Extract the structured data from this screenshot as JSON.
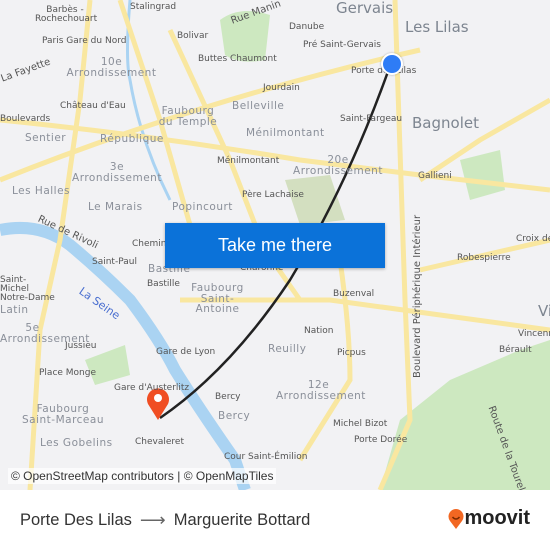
{
  "map": {
    "labels": [
      "Barbès - Rochechouart",
      "Stalingrad",
      "Rue Manin",
      "Gervais",
      "Les Lilas",
      "Bolivar",
      "Danube",
      "Paris Gare du Nord",
      "Pré Saint-Gervais",
      "La Fayette",
      "Buttes Chaumont",
      "Porte des Lilas",
      "10e Arrondissement",
      "Jourdain",
      "Château d'Eau",
      "Belleville",
      "Faubourg du Temple",
      "Bagnolet",
      "Saint-Fargeau",
      "Boulevards",
      "Sentier",
      "République",
      "Ménilmontant",
      "Ménilmontant",
      "20e Arrondissement",
      "Gallieni",
      "3e Arrondissement",
      "Les Halles",
      "Père Lachaise",
      "Le Marais",
      "Popincourt",
      "Rue de Rivoli",
      "Chemin",
      "Croix de",
      "Saint-Paul",
      "Bastille",
      "Charonne",
      "Robespierre",
      "Saint-Michel Notre-Dame",
      "Bastille",
      "Faubourg Saint-Antoine",
      "La Seine",
      "Buzenval",
      "Vi",
      "Latin",
      "5e Arrondissement",
      "Jussieu",
      "Nation",
      "Vincennes",
      "Reuilly",
      "Picpus",
      "Bérault",
      "Place Monge",
      "Gare de Lyon",
      "Boulevard Périphérique Intérieur",
      "Gare d'Austerlitz",
      "12e Arrondissement",
      "Route de la Tourelle",
      "Faubourg Saint-Marceau",
      "Bercy",
      "Bercy",
      "Michel Bizot",
      "Les Gobelins",
      "Chevaleret",
      "Porte Dorée",
      "Cour Saint-Émilion"
    ],
    "cta_label": "Take me there",
    "attribution": "© OpenStreetMap contributors | © OpenMapTiles",
    "origin_marker_color": "#2e7cf6",
    "destination_marker_color": "#f04e23"
  },
  "footer": {
    "origin": "Porte Des Lilas",
    "destination": "Marguerite Bottard",
    "arrow_icon": "arrow-right-icon",
    "brand": "moovit",
    "brand_color": "#f26722"
  }
}
